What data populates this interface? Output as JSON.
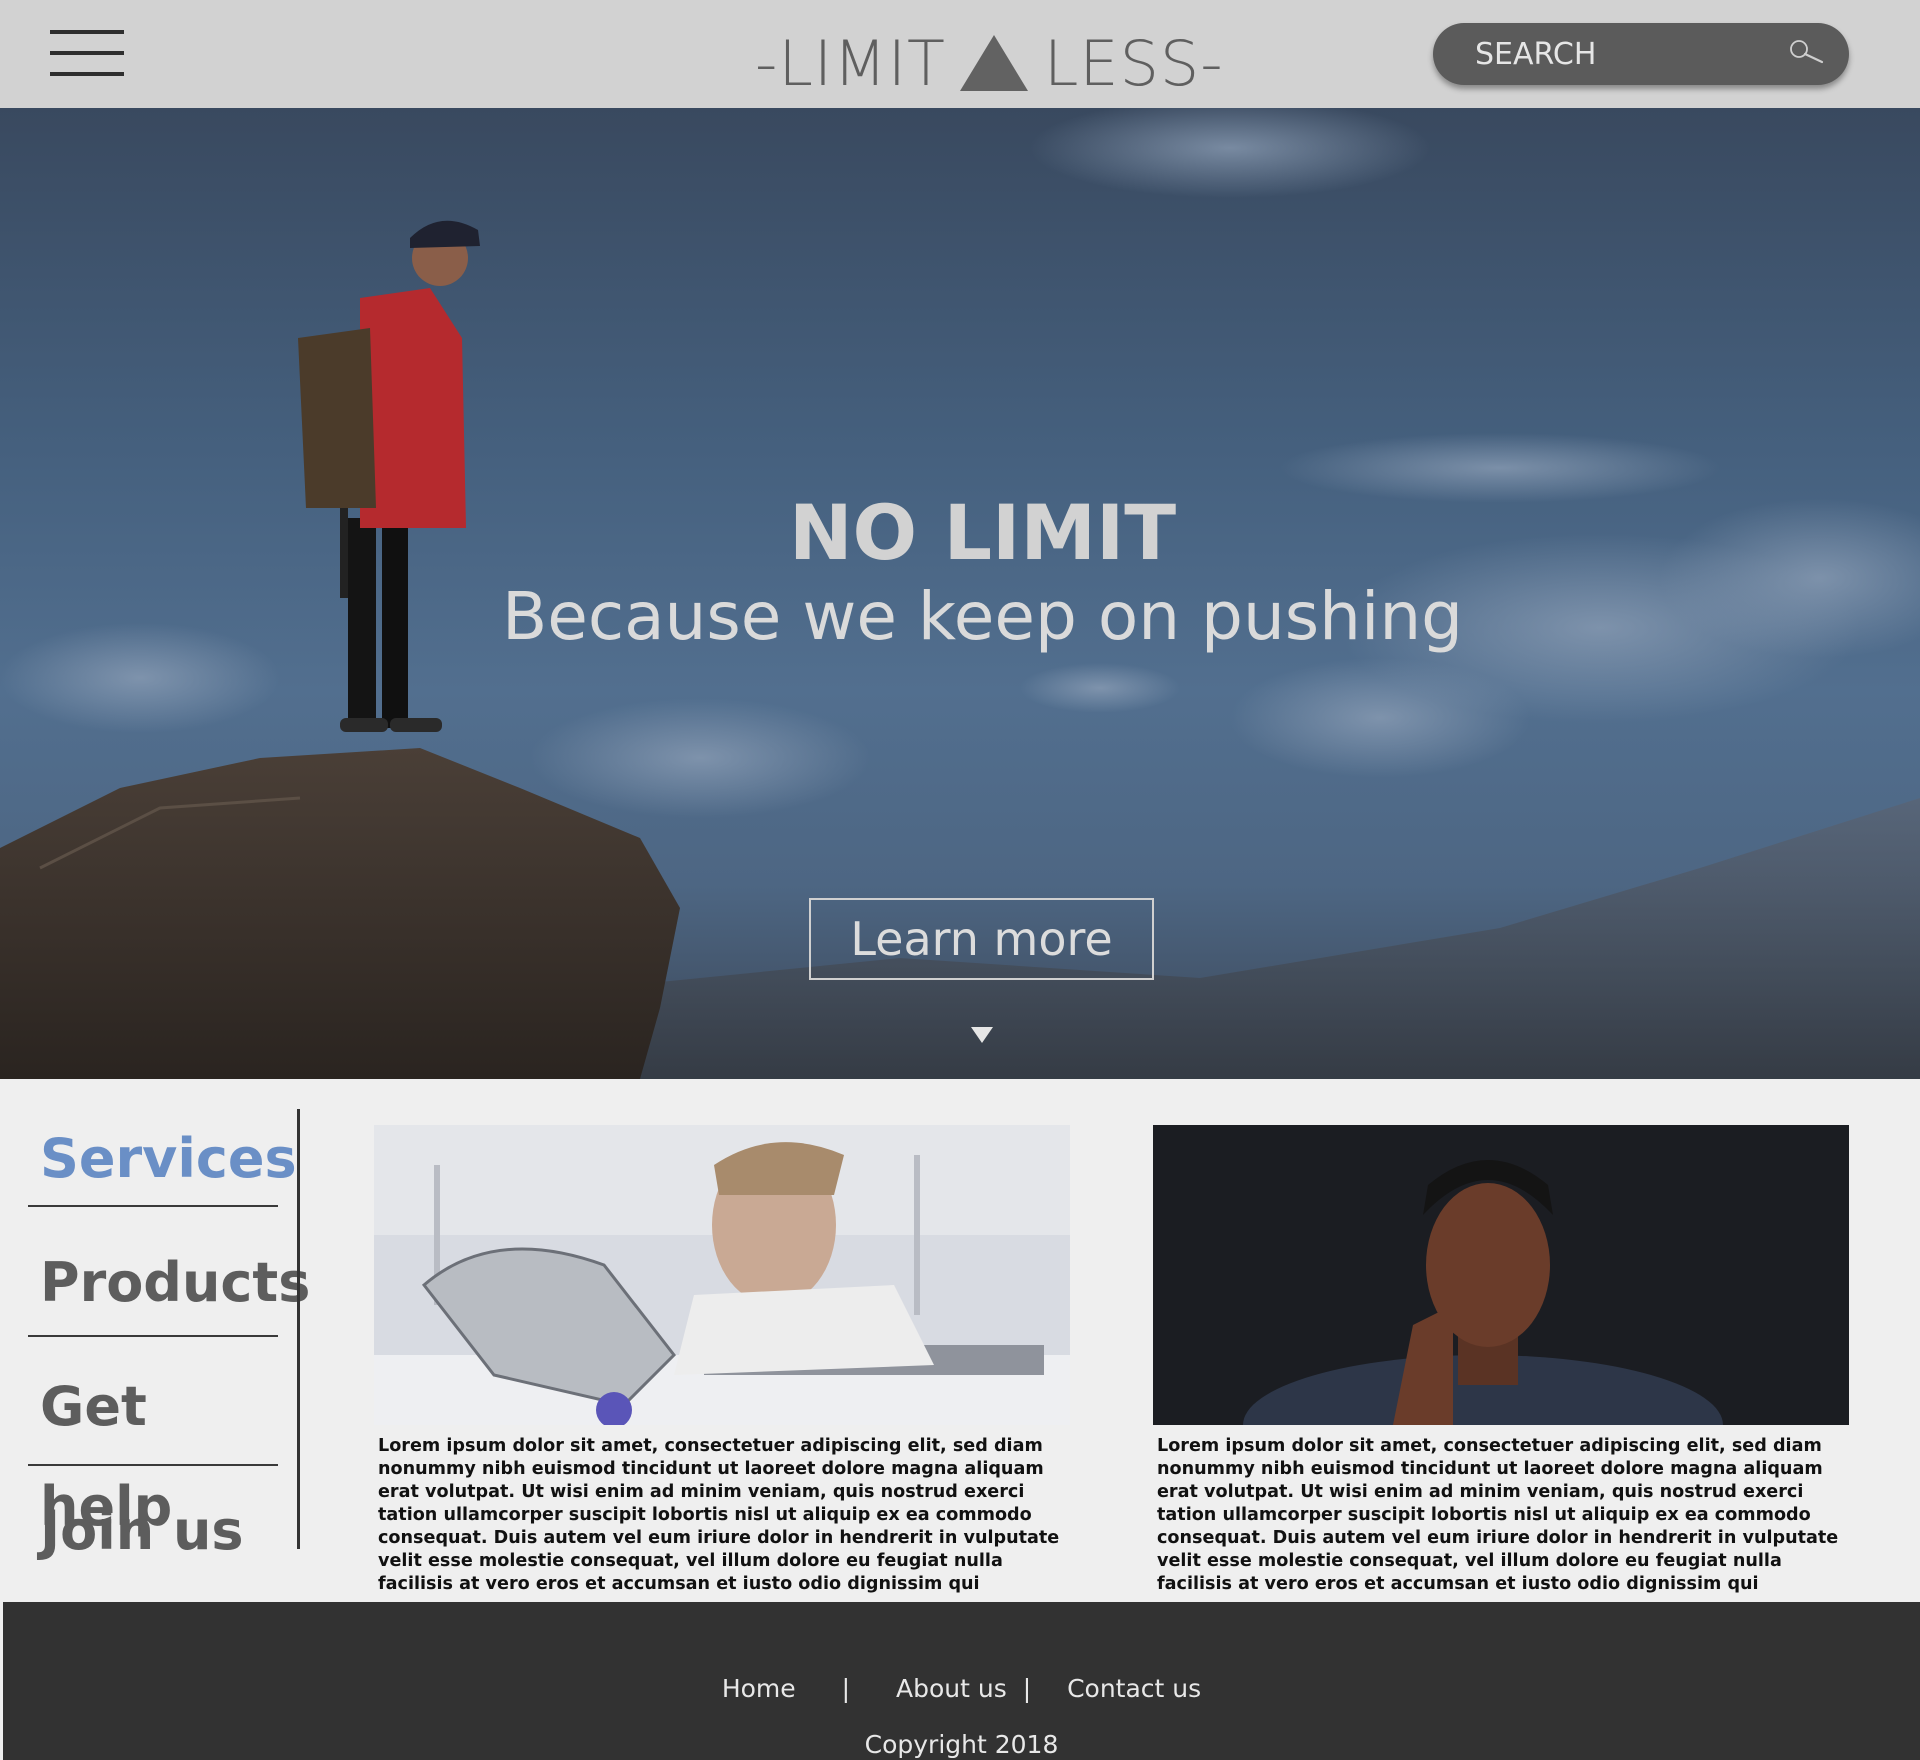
{
  "header": {
    "logo_left": "-LIMIT",
    "logo_right": "LESS-",
    "search_placeholder": "SEARCH"
  },
  "hero": {
    "title": "NO LIMIT",
    "subtitle": "Because we keep on pushing",
    "button_label": "Learn more"
  },
  "sidebar": {
    "items": [
      {
        "label": "Services",
        "active": true
      },
      {
        "label": "Products",
        "active": false
      },
      {
        "label": "Get help",
        "active": false
      },
      {
        "label": "Join us",
        "active": false
      }
    ]
  },
  "cards": [
    {
      "text": "Lorem ipsum dolor sit amet, consectetuer adipiscing elit, sed diam nonummy nibh euismod tincidunt ut laoreet dolore magna aliquam erat volutpat. Ut wisi enim ad minim veniam, quis nostrud exerci tation ullamcorper suscipit lobortis nisl ut aliquip ex ea commodo consequat. Duis autem vel eum iriure dolor in hendrerit in vulputate velit esse molestie consequat, vel illum dolore eu feugiat nulla facilisis at vero eros et accumsan et iusto odio dignissim qui"
    },
    {
      "text": "Lorem ipsum dolor sit amet, consectetuer adipiscing elit, sed diam nonummy nibh euismod tincidunt ut laoreet dolore magna aliquam erat volutpat. Ut wisi enim ad minim veniam, quis nostrud exerci tation ullamcorper suscipit lobortis nisl ut aliquip ex ea commodo consequat. Duis autem vel eum iriure dolor in hendrerit in vulputate velit esse molestie consequat, vel illum dolore eu feugiat nulla facilisis at vero eros et accumsan et iusto odio dignissim qui"
    }
  ],
  "footer": {
    "links": [
      "Home",
      "About us",
      "Contact us"
    ],
    "copyright": "Copyright 2018"
  },
  "colors": {
    "header_bg": "#d2d2d2",
    "search_bg": "#5b5b5b",
    "accent_active": "#6a8fc6",
    "footer_bg": "#323232"
  }
}
